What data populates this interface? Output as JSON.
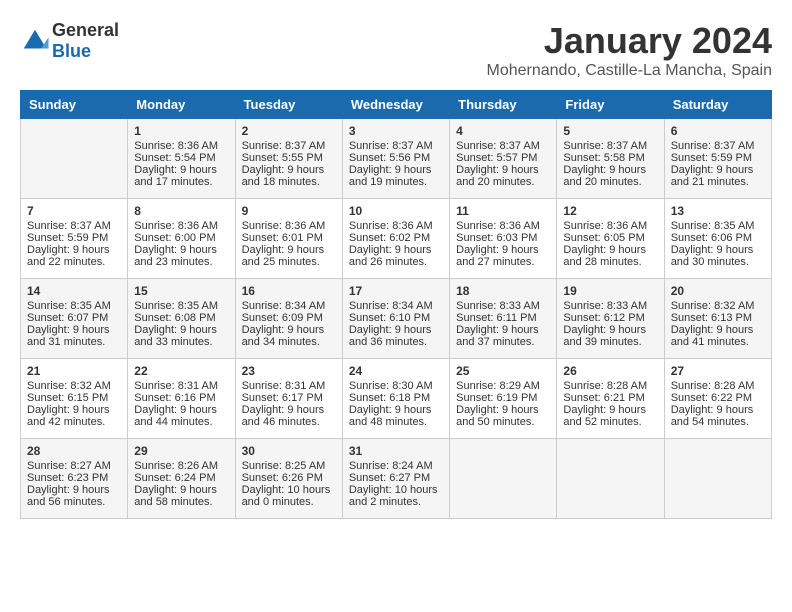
{
  "header": {
    "logo_general": "General",
    "logo_blue": "Blue",
    "title": "January 2024",
    "subtitle": "Mohernando, Castille-La Mancha, Spain"
  },
  "days_of_week": [
    "Sunday",
    "Monday",
    "Tuesday",
    "Wednesday",
    "Thursday",
    "Friday",
    "Saturday"
  ],
  "weeks": [
    [
      {
        "day": "",
        "sunrise": "",
        "sunset": "",
        "daylight": ""
      },
      {
        "day": "1",
        "sunrise": "Sunrise: 8:36 AM",
        "sunset": "Sunset: 5:54 PM",
        "daylight": "Daylight: 9 hours and 17 minutes."
      },
      {
        "day": "2",
        "sunrise": "Sunrise: 8:37 AM",
        "sunset": "Sunset: 5:55 PM",
        "daylight": "Daylight: 9 hours and 18 minutes."
      },
      {
        "day": "3",
        "sunrise": "Sunrise: 8:37 AM",
        "sunset": "Sunset: 5:56 PM",
        "daylight": "Daylight: 9 hours and 19 minutes."
      },
      {
        "day": "4",
        "sunrise": "Sunrise: 8:37 AM",
        "sunset": "Sunset: 5:57 PM",
        "daylight": "Daylight: 9 hours and 20 minutes."
      },
      {
        "day": "5",
        "sunrise": "Sunrise: 8:37 AM",
        "sunset": "Sunset: 5:58 PM",
        "daylight": "Daylight: 9 hours and 20 minutes."
      },
      {
        "day": "6",
        "sunrise": "Sunrise: 8:37 AM",
        "sunset": "Sunset: 5:59 PM",
        "daylight": "Daylight: 9 hours and 21 minutes."
      }
    ],
    [
      {
        "day": "7",
        "sunrise": "Sunrise: 8:37 AM",
        "sunset": "Sunset: 5:59 PM",
        "daylight": "Daylight: 9 hours and 22 minutes."
      },
      {
        "day": "8",
        "sunrise": "Sunrise: 8:36 AM",
        "sunset": "Sunset: 6:00 PM",
        "daylight": "Daylight: 9 hours and 23 minutes."
      },
      {
        "day": "9",
        "sunrise": "Sunrise: 8:36 AM",
        "sunset": "Sunset: 6:01 PM",
        "daylight": "Daylight: 9 hours and 25 minutes."
      },
      {
        "day": "10",
        "sunrise": "Sunrise: 8:36 AM",
        "sunset": "Sunset: 6:02 PM",
        "daylight": "Daylight: 9 hours and 26 minutes."
      },
      {
        "day": "11",
        "sunrise": "Sunrise: 8:36 AM",
        "sunset": "Sunset: 6:03 PM",
        "daylight": "Daylight: 9 hours and 27 minutes."
      },
      {
        "day": "12",
        "sunrise": "Sunrise: 8:36 AM",
        "sunset": "Sunset: 6:05 PM",
        "daylight": "Daylight: 9 hours and 28 minutes."
      },
      {
        "day": "13",
        "sunrise": "Sunrise: 8:35 AM",
        "sunset": "Sunset: 6:06 PM",
        "daylight": "Daylight: 9 hours and 30 minutes."
      }
    ],
    [
      {
        "day": "14",
        "sunrise": "Sunrise: 8:35 AM",
        "sunset": "Sunset: 6:07 PM",
        "daylight": "Daylight: 9 hours and 31 minutes."
      },
      {
        "day": "15",
        "sunrise": "Sunrise: 8:35 AM",
        "sunset": "Sunset: 6:08 PM",
        "daylight": "Daylight: 9 hours and 33 minutes."
      },
      {
        "day": "16",
        "sunrise": "Sunrise: 8:34 AM",
        "sunset": "Sunset: 6:09 PM",
        "daylight": "Daylight: 9 hours and 34 minutes."
      },
      {
        "day": "17",
        "sunrise": "Sunrise: 8:34 AM",
        "sunset": "Sunset: 6:10 PM",
        "daylight": "Daylight: 9 hours and 36 minutes."
      },
      {
        "day": "18",
        "sunrise": "Sunrise: 8:33 AM",
        "sunset": "Sunset: 6:11 PM",
        "daylight": "Daylight: 9 hours and 37 minutes."
      },
      {
        "day": "19",
        "sunrise": "Sunrise: 8:33 AM",
        "sunset": "Sunset: 6:12 PM",
        "daylight": "Daylight: 9 hours and 39 minutes."
      },
      {
        "day": "20",
        "sunrise": "Sunrise: 8:32 AM",
        "sunset": "Sunset: 6:13 PM",
        "daylight": "Daylight: 9 hours and 41 minutes."
      }
    ],
    [
      {
        "day": "21",
        "sunrise": "Sunrise: 8:32 AM",
        "sunset": "Sunset: 6:15 PM",
        "daylight": "Daylight: 9 hours and 42 minutes."
      },
      {
        "day": "22",
        "sunrise": "Sunrise: 8:31 AM",
        "sunset": "Sunset: 6:16 PM",
        "daylight": "Daylight: 9 hours and 44 minutes."
      },
      {
        "day": "23",
        "sunrise": "Sunrise: 8:31 AM",
        "sunset": "Sunset: 6:17 PM",
        "daylight": "Daylight: 9 hours and 46 minutes."
      },
      {
        "day": "24",
        "sunrise": "Sunrise: 8:30 AM",
        "sunset": "Sunset: 6:18 PM",
        "daylight": "Daylight: 9 hours and 48 minutes."
      },
      {
        "day": "25",
        "sunrise": "Sunrise: 8:29 AM",
        "sunset": "Sunset: 6:19 PM",
        "daylight": "Daylight: 9 hours and 50 minutes."
      },
      {
        "day": "26",
        "sunrise": "Sunrise: 8:28 AM",
        "sunset": "Sunset: 6:21 PM",
        "daylight": "Daylight: 9 hours and 52 minutes."
      },
      {
        "day": "27",
        "sunrise": "Sunrise: 8:28 AM",
        "sunset": "Sunset: 6:22 PM",
        "daylight": "Daylight: 9 hours and 54 minutes."
      }
    ],
    [
      {
        "day": "28",
        "sunrise": "Sunrise: 8:27 AM",
        "sunset": "Sunset: 6:23 PM",
        "daylight": "Daylight: 9 hours and 56 minutes."
      },
      {
        "day": "29",
        "sunrise": "Sunrise: 8:26 AM",
        "sunset": "Sunset: 6:24 PM",
        "daylight": "Daylight: 9 hours and 58 minutes."
      },
      {
        "day": "30",
        "sunrise": "Sunrise: 8:25 AM",
        "sunset": "Sunset: 6:26 PM",
        "daylight": "Daylight: 10 hours and 0 minutes."
      },
      {
        "day": "31",
        "sunrise": "Sunrise: 8:24 AM",
        "sunset": "Sunset: 6:27 PM",
        "daylight": "Daylight: 10 hours and 2 minutes."
      },
      {
        "day": "",
        "sunrise": "",
        "sunset": "",
        "daylight": ""
      },
      {
        "day": "",
        "sunrise": "",
        "sunset": "",
        "daylight": ""
      },
      {
        "day": "",
        "sunrise": "",
        "sunset": "",
        "daylight": ""
      }
    ]
  ]
}
